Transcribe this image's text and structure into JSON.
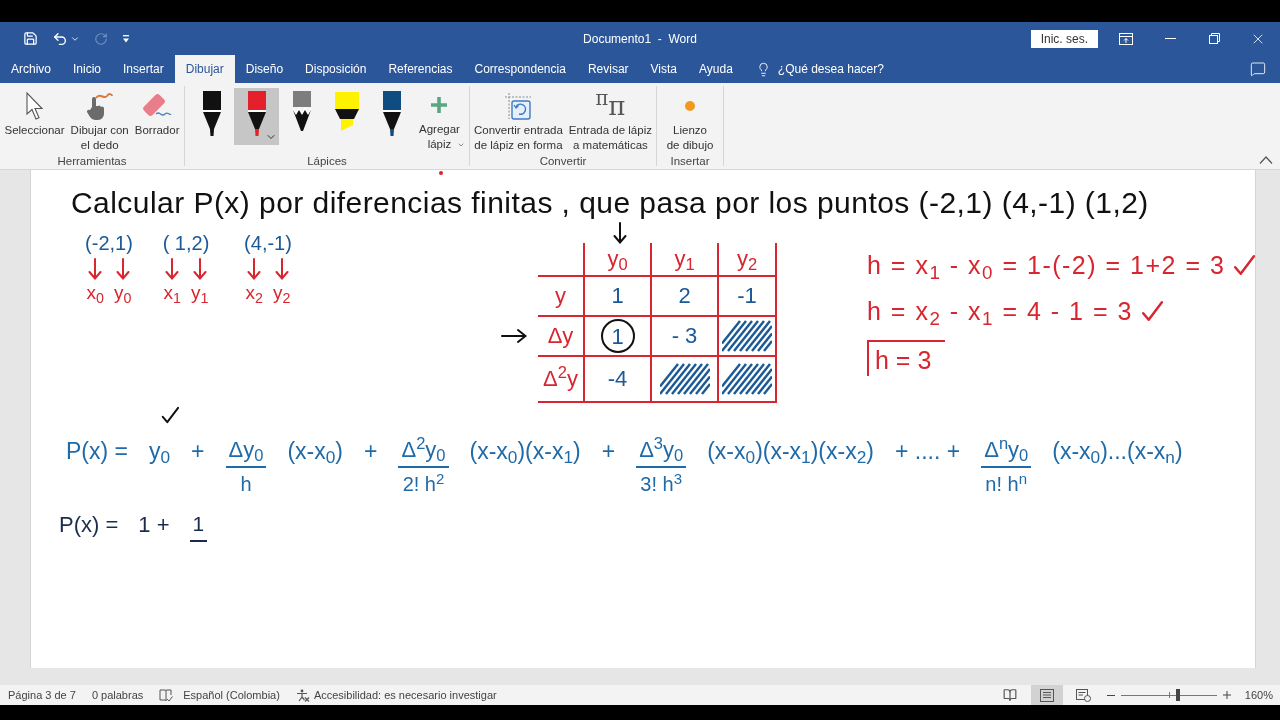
{
  "title_bar": {
    "quick_access": [
      {
        "kind": "save",
        "disabled": false
      },
      {
        "kind": "undo",
        "disabled": false
      },
      {
        "kind": "redo",
        "disabled": true
      },
      {
        "kind": "customize",
        "disabled": false
      }
    ],
    "title": "Documento1  -  Word",
    "sign_in": "Inic. ses."
  },
  "tabs": [
    {
      "label": "Archivo",
      "selected": false
    },
    {
      "label": "Inicio",
      "selected": false
    },
    {
      "label": "Insertar",
      "selected": false
    },
    {
      "label": "Dibujar",
      "selected": true
    },
    {
      "label": "Diseño",
      "selected": false
    },
    {
      "label": "Disposición",
      "selected": false
    },
    {
      "label": "Referencias",
      "selected": false
    },
    {
      "label": "Correspondencia",
      "selected": false
    },
    {
      "label": "Revisar",
      "selected": false
    },
    {
      "label": "Vista",
      "selected": false
    },
    {
      "label": "Ayuda",
      "selected": false
    }
  ],
  "tell_me": {
    "label": "¿Qué desea hacer?"
  },
  "ribbon": {
    "tools": {
      "label": "Herramientas",
      "buttons": [
        {
          "kind": "select",
          "label": "Seleccionar"
        },
        {
          "kind": "finger",
          "label": "Dibujar con\nel dedo"
        },
        {
          "kind": "eraser",
          "label": "Borrador"
        }
      ]
    },
    "pens": {
      "label": "Lápices",
      "pens": [
        {
          "kind": "pen",
          "color": "#111111",
          "selected": false
        },
        {
          "kind": "pen",
          "color": "#e3202b",
          "selected": true
        },
        {
          "kind": "pencil",
          "color": "#7d7d7d",
          "selected": false
        },
        {
          "kind": "highlighter",
          "color": "#fff200",
          "selected": false
        },
        {
          "kind": "pen",
          "color": "#0f4c81",
          "selected": false
        }
      ],
      "add_button": {
        "label": "Agregar\nlápiz"
      }
    },
    "convert": {
      "label": "Convertir",
      "buttons": [
        {
          "kind": "shape",
          "label": "Convertir entrada\nde lápiz en forma"
        },
        {
          "kind": "math",
          "glyph": "$^{π}$π",
          "label": "Entrada de lápiz\na matemáticas"
        }
      ]
    },
    "insert": {
      "label": "Insertar",
      "buttons": [
        {
          "kind": "canvas",
          "label": "Lienzo\nde dibujo"
        }
      ]
    }
  },
  "document": {
    "heading": "Calcular P(x) por diferencias finitas , que pasa por los puntos (-2,1) (4,-1) (1,2)",
    "points": [
      {
        "point": "(-2,1)",
        "x_label": "x$_{0}$",
        "y_label": "y$_{0}$"
      },
      {
        "point": "( 1,2)",
        "x_label": "x$_{1}$",
        "y_label": "y$_{1}$"
      },
      {
        "point": "(4,-1)",
        "x_label": "x$_{2}$",
        "y_label": "y$_{2}$"
      }
    ],
    "table": {
      "columns": [
        "y$_{0}$",
        "y$_{1}$",
        "y$_{2}$"
      ],
      "rows": [
        {
          "label": "y",
          "pointer": false,
          "cells": [
            {
              "kind": "value",
              "value": "1",
              "circled": false
            },
            {
              "kind": "value",
              "value": "2",
              "circled": false
            },
            {
              "kind": "value",
              "value": "-1",
              "circled": false
            }
          ]
        },
        {
          "label": "Δy",
          "pointer": true,
          "cells": [
            {
              "kind": "value",
              "value": "1",
              "circled": true
            },
            {
              "kind": "value",
              "value": "- 3",
              "circled": false
            },
            {
              "kind": "hatched"
            }
          ]
        },
        {
          "label": "Δ$^{2}$y",
          "pointer": false,
          "cells": [
            {
              "kind": "value",
              "value": "-4",
              "circled": false
            },
            {
              "kind": "hatched"
            },
            {
              "kind": "hatched"
            }
          ]
        }
      ]
    },
    "steps": [
      {
        "text": "h = x$_{1}$ - x$_{0}$ = 1-(-2) = 1+2 = 3",
        "checked": true
      },
      {
        "text": "h = x$_{2}$ - x$_{1}$ = 4 - 1 = 3",
        "checked": true
      }
    ],
    "result": "h = 3",
    "formula": [
      {
        "kind": "text",
        "text": "P(x) ="
      },
      {
        "kind": "text",
        "text": "y$_{0}$"
      },
      {
        "kind": "text",
        "text": "+"
      },
      {
        "kind": "fraction",
        "numerator": "Δy$_{0}$",
        "denominator": "h"
      },
      {
        "kind": "text",
        "text": "(x-x$_{0}$)"
      },
      {
        "kind": "text",
        "text": "+"
      },
      {
        "kind": "fraction",
        "numerator": "Δ$^{2}$y$_{0}$",
        "denominator": "2! h$^{2}$"
      },
      {
        "kind": "text",
        "text": "(x-x$_{0}$)(x-x$_{1}$)"
      },
      {
        "kind": "text",
        "text": "+"
      },
      {
        "kind": "fraction",
        "numerator": "Δ$^{3}$y$_{0}$",
        "denominator": "3! h$^{3}$"
      },
      {
        "kind": "text",
        "text": "(x-x$_{0}$)(x-x$_{1}$)(x-x$_{2}$)"
      },
      {
        "kind": "text",
        "text": "+ .... +"
      },
      {
        "kind": "fraction",
        "numerator": "Δ$^{n}$y$_{0}$",
        "denominator": "n! h$^{n}$"
      },
      {
        "kind": "text",
        "text": "(x-x$_{0}$)...(x-x$_{n}$)"
      }
    ],
    "substitution": [
      {
        "kind": "text",
        "text": "P(x) ="
      },
      {
        "kind": "text",
        "text": "1 +"
      },
      {
        "kind": "fraction",
        "numerator": "1"
      }
    ]
  },
  "status_bar": {
    "page": "Página 3 de 7",
    "words": "0 palabras",
    "language": "Español (Colombia)",
    "accessibility": "Accesibilidad: es necesario investigar",
    "views": [
      {
        "kind": "read",
        "selected": false
      },
      {
        "kind": "print",
        "selected": true
      },
      {
        "kind": "web",
        "selected": false
      }
    ],
    "zoom": {
      "level": 0.6,
      "reading": "160%"
    }
  }
}
